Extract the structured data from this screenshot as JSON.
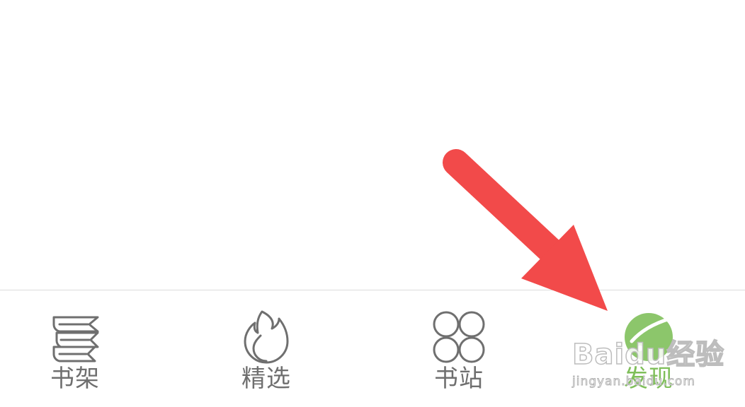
{
  "tabbar": {
    "tabs": [
      {
        "label": "书架",
        "icon": "bookshelf-icon",
        "active": false
      },
      {
        "label": "精选",
        "icon": "flame-icon",
        "active": false
      },
      {
        "label": "书站",
        "icon": "four-circles-icon",
        "active": false
      },
      {
        "label": "发现",
        "icon": "discover-icon",
        "active": true
      }
    ]
  },
  "colors": {
    "icon_gray": "#6f6f6f",
    "active_green": "#7fbf5a",
    "arrow_red": "#f24a4a"
  },
  "watermark": {
    "line1": "Baidu经验",
    "line2": "jingyan.baidu.com"
  }
}
